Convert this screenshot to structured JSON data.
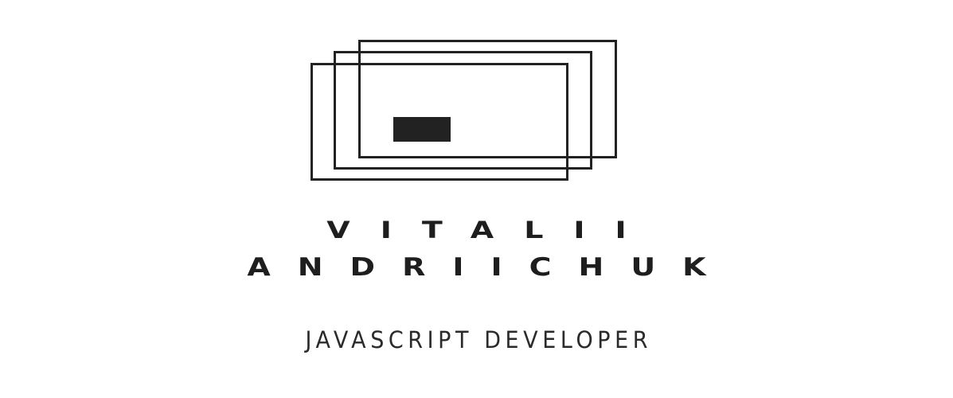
{
  "logo": {
    "name_line_1": "VITALII",
    "name_line_2": "ANDRIICHUK",
    "tagline": "JAVASCRIPT DEVELOPER"
  },
  "colors": {
    "background": "#ffffff",
    "ink": "#1e1e1e"
  }
}
